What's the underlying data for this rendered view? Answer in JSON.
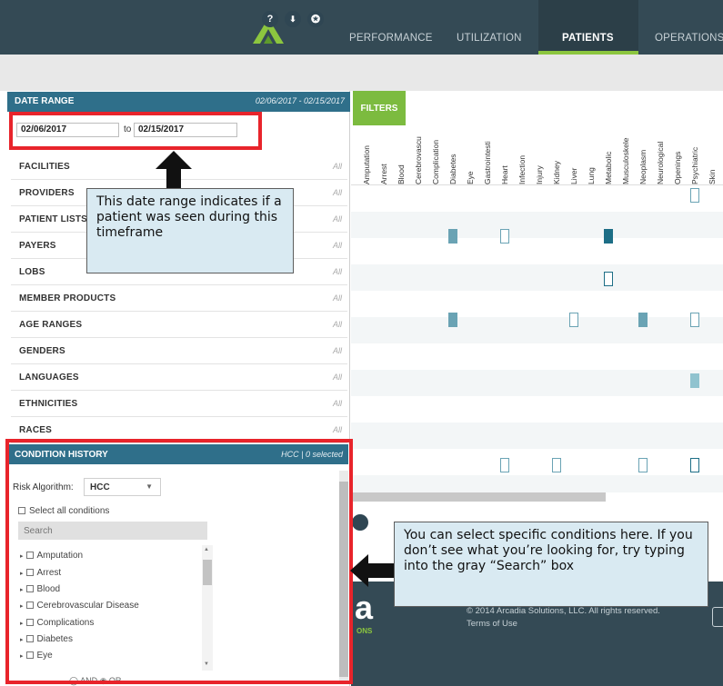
{
  "nav": {
    "tabs": [
      "PERFORMANCE",
      "UTILIZATION",
      "PATIENTS",
      "OPERATIONS"
    ],
    "active_tab": "PATIENTS",
    "brand_color": "#8cc63f"
  },
  "toolbar": {
    "icons": [
      "help-icon",
      "download-icon",
      "settings-icon"
    ],
    "help_glyph": "?",
    "download_glyph": "⬇",
    "star_glyph": "✪"
  },
  "date_range": {
    "header": "DATE RANGE",
    "summary": "02/06/2017 - 02/15/2017",
    "from": "02/06/2017",
    "to_label": "to",
    "to": "02/15/2017"
  },
  "filters": {
    "tab_label": "FILTERS",
    "rows": [
      {
        "name": "FACILITIES",
        "value": "All"
      },
      {
        "name": "PROVIDERS",
        "value": "All"
      },
      {
        "name": "PATIENT LISTS",
        "value": "All"
      },
      {
        "name": "PAYERS",
        "value": "All"
      },
      {
        "name": "LOBS",
        "value": "All"
      },
      {
        "name": "MEMBER PRODUCTS",
        "value": "All"
      },
      {
        "name": "AGE RANGES",
        "value": "All"
      },
      {
        "name": "GENDERS",
        "value": "All"
      },
      {
        "name": "LANGUAGES",
        "value": "All"
      },
      {
        "name": "ETHNICITIES",
        "value": "All"
      },
      {
        "name": "RACES",
        "value": "All"
      }
    ]
  },
  "condition_history": {
    "header": "CONDITION HISTORY",
    "summary": "HCC | 0 selected",
    "risk_label": "Risk Algorithm:",
    "risk_value": "HCC",
    "select_all": "Select all conditions",
    "search_placeholder": "Search",
    "conditions": [
      "Amputation",
      "Arrest",
      "Blood",
      "Cerebrovascular Disease",
      "Complications",
      "Diabetes",
      "Eye"
    ],
    "and_or": "◯ AND   ◉ OR"
  },
  "grid": {
    "columns": [
      "Amputation",
      "Arrest",
      "Blood",
      "Cerebrovascu",
      "Complication",
      "Diabetes",
      "Eye",
      "Gastrointesti",
      "Heart",
      "Infection",
      "Injury",
      "Kidney",
      "Liver",
      "Lung",
      "Metabolic",
      "Musculoskele",
      "Neoplasm",
      "Neurological",
      "Openings",
      "Psychiatric",
      "Skin"
    ]
  },
  "footer": {
    "logo_letter": "a",
    "logo_sub": "ONS",
    "copyright": "© 2014 Arcadia Solutions, LLC. All rights reserved. Terms of Use"
  },
  "callouts": {
    "date_range": "This date range indicates if a patient was seen during this timeframe",
    "conditions": "You can select specific conditions here.  If you don’t see what you’re looking for, try typing into the gray “Search” box"
  }
}
